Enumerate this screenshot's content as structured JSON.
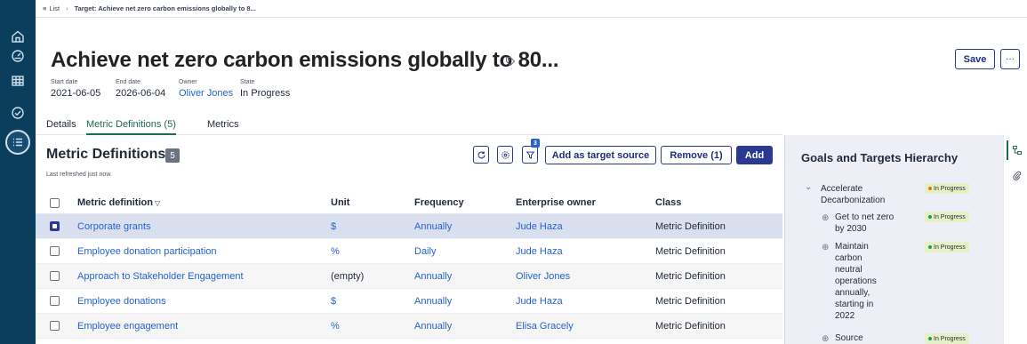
{
  "breadcrumb": {
    "list_label": "List",
    "current": "Target: Achieve net zero carbon emissions globally to 8..."
  },
  "header": {
    "title": "Achieve net zero carbon emissions globally to 80...",
    "save_label": "Save",
    "more_label": "···",
    "meta": [
      {
        "label": "Start date",
        "value": "2021-06-05"
      },
      {
        "label": "End date",
        "value": "2026-06-04"
      },
      {
        "label": "Owner",
        "value": "Oliver Jones"
      },
      {
        "label": "State",
        "value": "In Progress"
      }
    ]
  },
  "tabs": [
    {
      "label": "Details"
    },
    {
      "label": "Metric Definitions (5)"
    },
    {
      "label": "Metrics"
    }
  ],
  "section": {
    "title": "Metric Definitions",
    "count": "5",
    "refreshed": "Last refreshed just now.",
    "filter_badge": "3",
    "add_target_source_label": "Add as target source",
    "remove_label": "Remove (1)",
    "add_label": "Add"
  },
  "table": {
    "columns": [
      "Metric definition",
      "Unit",
      "Frequency",
      "Enterprise owner",
      "Class"
    ],
    "rows": [
      {
        "name": "Corporate grants",
        "unit": "$",
        "frequency": "Annually",
        "owner": "Jude Haza",
        "class": "Metric Definition",
        "checked": true
      },
      {
        "name": "Employee donation participation",
        "unit": "%",
        "frequency": "Daily",
        "owner": "Jude Haza",
        "class": "Metric Definition",
        "checked": false
      },
      {
        "name": "Approach to Stakeholder Engagement",
        "unit": "(empty)",
        "frequency": "Annually",
        "owner": "Oliver Jones",
        "class": "Metric Definition",
        "checked": false
      },
      {
        "name": "Employee donations",
        "unit": "$",
        "frequency": "Annually",
        "owner": "Jude Haza",
        "class": "Metric Definition",
        "checked": false
      },
      {
        "name": "Employee engagement",
        "unit": "%",
        "frequency": "Annually",
        "owner": "Elisa Gracely",
        "class": "Metric Definition",
        "checked": false
      }
    ]
  },
  "hierarchy": {
    "title": "Goals and Targets Hierarchy",
    "root": {
      "label": "Accelerate Decarbonization",
      "state": "In Progress",
      "state_color": "#d97706"
    },
    "children": [
      {
        "label": "Get to net zero by 2030",
        "state": "In Progress",
        "state_color": "#16a34a"
      },
      {
        "label": "Maintain carbon neutral operations annually, starting in 2022",
        "state": "In Progress",
        "state_color": "#16a34a"
      },
      {
        "label": "Source",
        "state": "In Progress",
        "state_color": "#16a34a"
      }
    ]
  },
  "colors": {
    "rail": "#0b3d5c",
    "accent": "#2b3a8f",
    "link": "#2563c9",
    "active_tab": "#1f6b4a"
  }
}
